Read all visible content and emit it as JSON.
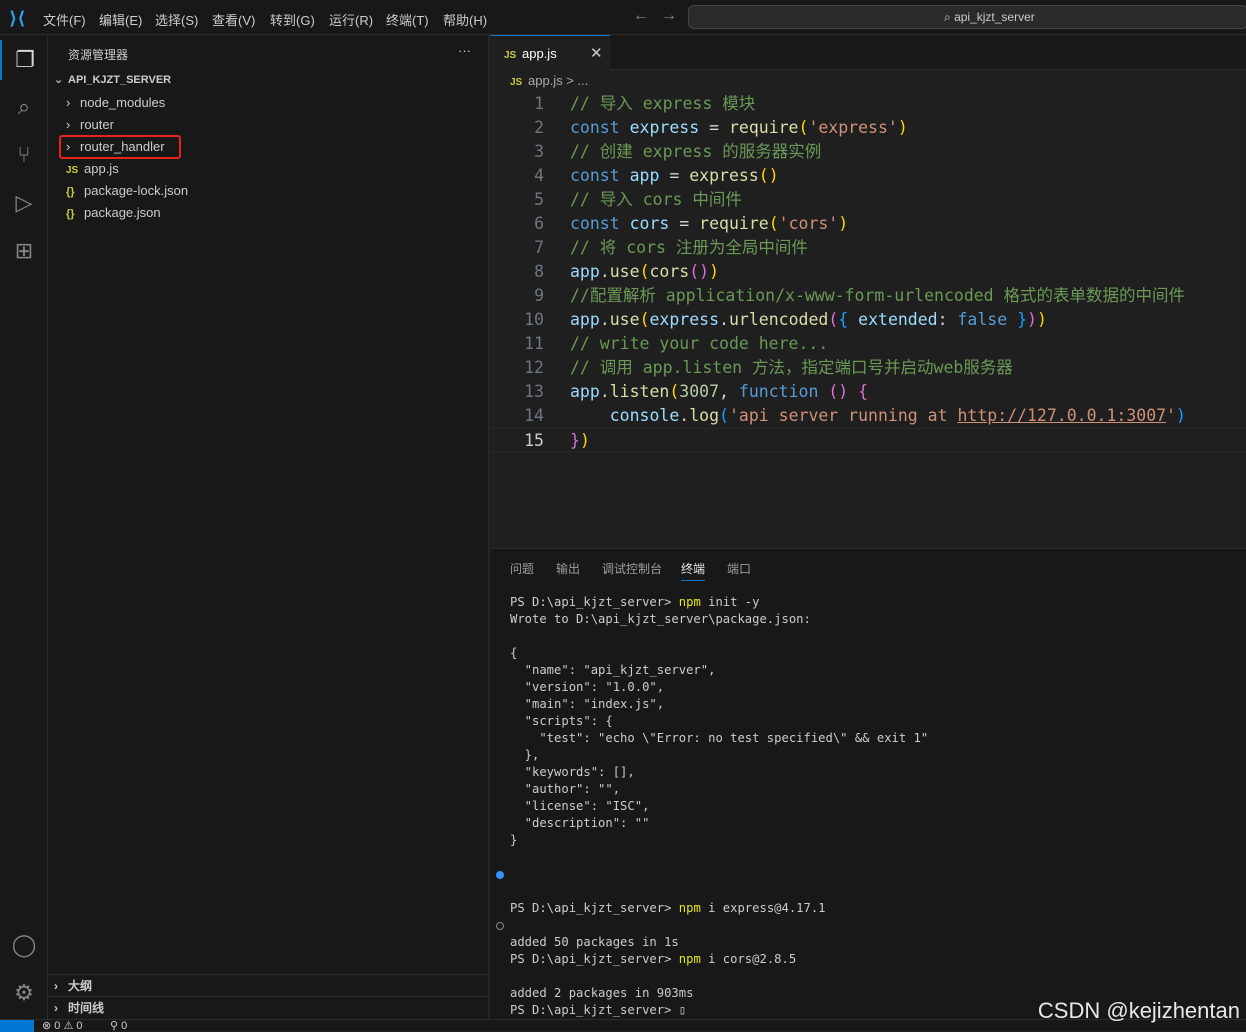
{
  "titlebar": {
    "menus": [
      "文件(F)",
      "编辑(E)",
      "选择(S)",
      "查看(V)",
      "转到(G)",
      "运行(R)",
      "终端(T)",
      "帮助(H)"
    ],
    "search": "api_kjzt_server"
  },
  "sidebar": {
    "title": "资源管理器",
    "more": "···",
    "root": "API_KJZT_SERVER",
    "items": [
      {
        "label": "node_modules",
        "kind": "folder"
      },
      {
        "label": "router",
        "kind": "folder"
      },
      {
        "label": "router_handler",
        "kind": "folder",
        "highlighted": true
      },
      {
        "label": "app.js",
        "kind": "js"
      },
      {
        "label": "package-lock.json",
        "kind": "json"
      },
      {
        "label": "package.json",
        "kind": "json"
      }
    ],
    "sections": [
      "大纲",
      "时间线"
    ]
  },
  "editor": {
    "tab": "app.js",
    "tab_icon": "JS",
    "breadcrumb": "app.js > ...",
    "current_line": 15,
    "lines": [
      [
        [
          "// 导入 express 模块",
          "comment"
        ]
      ],
      [
        [
          "const",
          "kw"
        ],
        [
          " express ",
          "var"
        ],
        [
          "= ",
          "plain"
        ],
        [
          "require",
          "fn"
        ],
        [
          "(",
          "p1"
        ],
        [
          "'express'",
          "str"
        ],
        [
          ")",
          "p1"
        ]
      ],
      [
        [
          "// 创建 express 的服务器实例",
          "comment"
        ]
      ],
      [
        [
          "const",
          "kw"
        ],
        [
          " app",
          "var"
        ],
        [
          " = ",
          "plain"
        ],
        [
          "express",
          "fn"
        ],
        [
          "()",
          "p1"
        ]
      ],
      [
        [
          "// 导入 cors 中间件",
          "comment"
        ]
      ],
      [
        [
          "const",
          "kw"
        ],
        [
          " cors ",
          "var"
        ],
        [
          "= ",
          "plain"
        ],
        [
          "require",
          "fn"
        ],
        [
          "(",
          "p1"
        ],
        [
          "'cors'",
          "str"
        ],
        [
          ")",
          "p1"
        ]
      ],
      [
        [
          "// 将 cors 注册为全局中间件",
          "comment"
        ]
      ],
      [
        [
          "app",
          "var"
        ],
        [
          ".",
          "plain"
        ],
        [
          "use",
          "fn"
        ],
        [
          "(",
          "p1"
        ],
        [
          "cors",
          "fn"
        ],
        [
          "()",
          "p2"
        ],
        [
          ")",
          "p1"
        ]
      ],
      [
        [
          "//配置解析 application/x-www-form-urlencoded 格式的表单数据的中间件",
          "comment"
        ]
      ],
      [
        [
          "app",
          "var"
        ],
        [
          ".",
          "plain"
        ],
        [
          "use",
          "fn"
        ],
        [
          "(",
          "p1"
        ],
        [
          "express",
          "var"
        ],
        [
          ".",
          "plain"
        ],
        [
          "urlencoded",
          "fn"
        ],
        [
          "(",
          "p2"
        ],
        [
          "{",
          "p3"
        ],
        [
          " extended",
          "var"
        ],
        [
          ": ",
          "plain"
        ],
        [
          "false",
          "kw"
        ],
        [
          " }",
          "p3"
        ],
        [
          ")",
          "p2"
        ],
        [
          ")",
          "p1"
        ]
      ],
      [
        [
          "// write your code here...",
          "comment"
        ]
      ],
      [
        [
          "// 调用 app.listen 方法，指定端口号并启动web服务器",
          "comment"
        ]
      ],
      [
        [
          "app",
          "var"
        ],
        [
          ".",
          "plain"
        ],
        [
          "listen",
          "fn"
        ],
        [
          "(",
          "p1"
        ],
        [
          "3007",
          "num"
        ],
        [
          ", ",
          "plain"
        ],
        [
          "function",
          "kw"
        ],
        [
          " ()",
          "p2"
        ],
        [
          " {",
          "p2"
        ]
      ],
      [
        [
          "    console",
          "var"
        ],
        [
          ".",
          "plain"
        ],
        [
          "log",
          "fn"
        ],
        [
          "(",
          "p3"
        ],
        [
          "'api server running at ",
          "str"
        ],
        [
          "http://127.0.0.1:3007",
          "url"
        ],
        [
          "'",
          "str"
        ],
        [
          ")",
          "p3"
        ]
      ],
      [
        [
          "}",
          "p2"
        ],
        [
          ")",
          "p1"
        ]
      ]
    ]
  },
  "panel": {
    "tabs": [
      "问题",
      "输出",
      "调试控制台",
      "终端",
      "端口"
    ],
    "active_tab": "终端",
    "terminal": [
      {
        "t": "PS D:\\api_kjzt_server> ",
        "cmd": "npm",
        "rest": " init -y"
      },
      {
        "t": "Wrote to D:\\api_kjzt_server\\package.json:"
      },
      {
        "t": ""
      },
      {
        "t": "{"
      },
      {
        "t": "  \"name\": \"api_kjzt_server\","
      },
      {
        "t": "  \"version\": \"1.0.0\","
      },
      {
        "t": "  \"main\": \"index.js\","
      },
      {
        "t": "  \"scripts\": {"
      },
      {
        "t": "    \"test\": \"echo \\\"Error: no test specified\\\" && exit 1\""
      },
      {
        "t": "  },"
      },
      {
        "t": "  \"keywords\": [],"
      },
      {
        "t": "  \"author\": \"\","
      },
      {
        "t": "  \"license\": \"ISC\","
      },
      {
        "t": "  \"description\": \"\""
      },
      {
        "t": "}"
      },
      {
        "t": ""
      },
      {
        "t": "",
        "mark": "dot"
      },
      {
        "t": ""
      },
      {
        "t": "PS D:\\api_kjzt_server> ",
        "cmd": "npm",
        "rest": " i express@4.17.1"
      },
      {
        "t": "",
        "mark": "ring"
      },
      {
        "t": "added 50 packages in 1s"
      },
      {
        "t": "PS D:\\api_kjzt_server> ",
        "cmd": "npm",
        "rest": " i cors@2.8.5"
      },
      {
        "t": ""
      },
      {
        "t": "added 2 packages in 903ms"
      },
      {
        "t": "PS D:\\api_kjzt_server> ",
        "rest": "▯"
      }
    ]
  },
  "status": {
    "errors": "0",
    "warnings": "0",
    "ports": "0"
  },
  "watermark": "CSDN @kejizhentan"
}
